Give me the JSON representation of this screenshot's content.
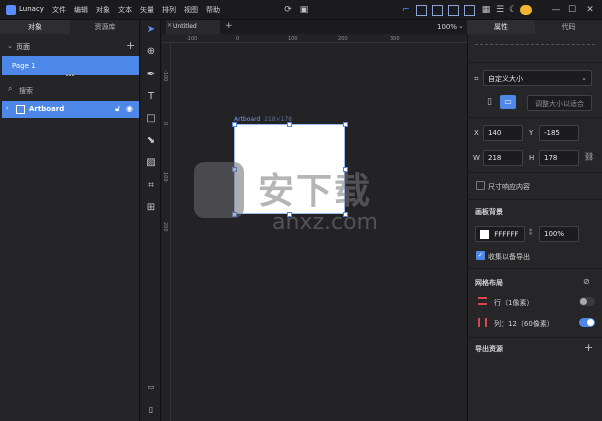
{
  "app": {
    "name": "Lunacy"
  },
  "menu": [
    "文件",
    "编辑",
    "对象",
    "文本",
    "矢量",
    "排列",
    "视图",
    "帮助"
  ],
  "left_panel": {
    "tabs": [
      "对象",
      "资源库"
    ],
    "pages_label": "页面",
    "page_name": "Page 1",
    "search_placeholder": "搜索",
    "layer_name": "Artboard"
  },
  "document": {
    "tab_title": "Untitled",
    "zoom": "100%",
    "ruler_h": [
      "-100",
      "0",
      "100",
      "200",
      "300"
    ],
    "ruler_v": [
      "-100",
      "0",
      "100",
      "200"
    ],
    "artboard_label": "Artboard",
    "artboard_size": "218×178"
  },
  "right_panel": {
    "tabs": [
      "属性",
      "代码"
    ],
    "preset": "自定义大小",
    "fit_button": "调整大小以适合",
    "x_label": "X",
    "x_value": "140",
    "y_label": "Y",
    "y_value": "-185",
    "w_label": "W",
    "w_value": "218",
    "h_label": "H",
    "h_value": "178",
    "resize_content": "尺寸响应内容",
    "bg_section": "画板背景",
    "bg_color": "FFFFFF",
    "bg_opacity": "100%",
    "include_export": "收集以备导出",
    "grid_section": "网格布局",
    "grid_rows": "行（1像素）",
    "grid_cols": "列：12（60像素）",
    "export_section": "导出资源"
  },
  "watermark": {
    "text": "安下载",
    "domain": "anxz.com"
  },
  "colors": {
    "accent": "#4d87e8",
    "panel": "#262629",
    "canvas": "#232326"
  }
}
